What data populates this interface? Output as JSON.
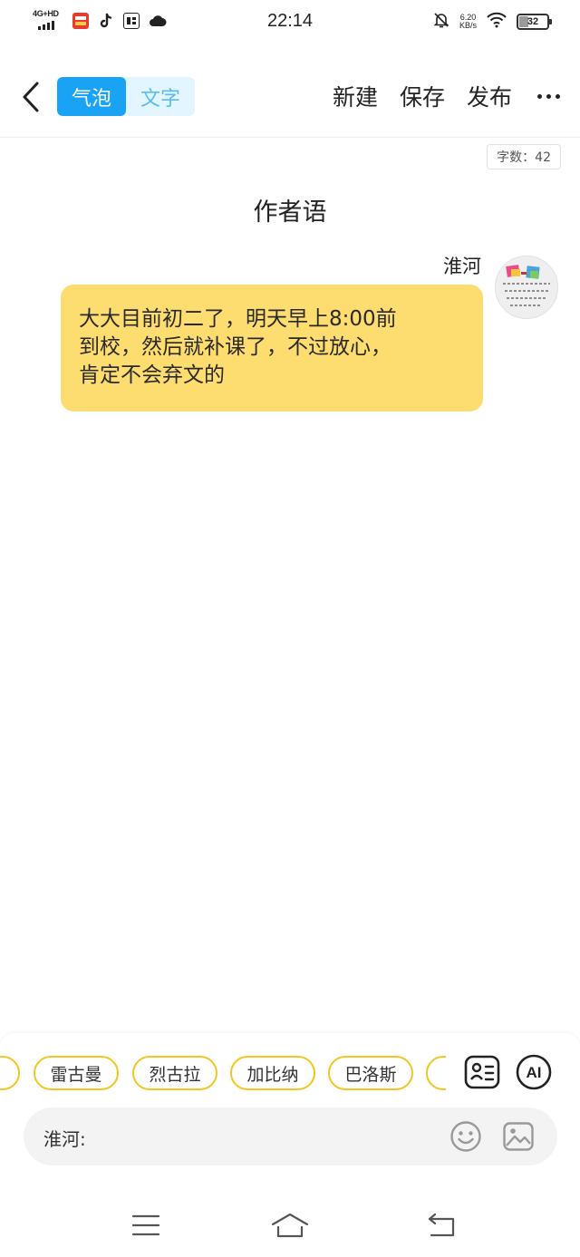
{
  "status_bar": {
    "network_label": "4G+HD",
    "time": "22:14",
    "speed_value": "6.20",
    "speed_unit": "KB/s",
    "battery": "32",
    "app_icons": [
      "toutiao-news-icon",
      "tiktok-icon",
      "toutiao-icon",
      "cloud-icon"
    ]
  },
  "header": {
    "mode_bubble": "气泡",
    "mode_text": "文字",
    "new_label": "新建",
    "save_label": "保存",
    "publish_label": "发布",
    "accent": "#1aa3f5"
  },
  "content": {
    "word_count": "字数：42",
    "title": "作者语",
    "speaker": "淮河",
    "message_lines": [
      "大大目前初二了，明天早上8:00前",
      "到校，然后就补课了，不过放心，",
      "肯定不会弃文的"
    ],
    "bubble_color": "#fddd6f"
  },
  "bottom_panel": {
    "characters": [
      "雷古曼",
      "烈古拉",
      "加比纳",
      "巴洛斯"
    ],
    "ai_label": "AI",
    "input_prefix": "淮河:",
    "chip_border_color": "#f1c621"
  }
}
